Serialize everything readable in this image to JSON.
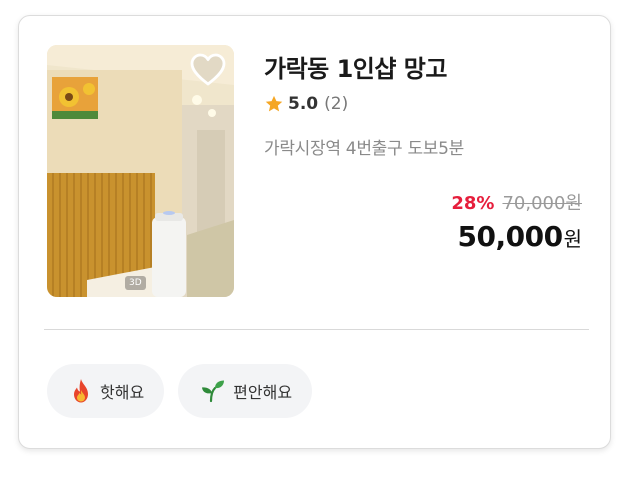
{
  "listing": {
    "title": "가락동 1인샵 망고",
    "rating": {
      "score": "5.0",
      "count": "(2)",
      "icon": "star-icon"
    },
    "location": "가락시장역 4번출구 도보5분",
    "price": {
      "discount": "28%",
      "original": "70,000원",
      "final_amount": "50,000",
      "final_unit": "원"
    },
    "thumbnail": {
      "tag": "3D"
    },
    "favorite_icon": "heart-outline-icon"
  },
  "tags": [
    {
      "label": "핫해요",
      "icon": "fire-icon"
    },
    {
      "label": "편안해요",
      "icon": "sprout-icon"
    }
  ],
  "colors": {
    "discount": "#e61e3c",
    "star": "#f5a623",
    "chip_bg": "#f3f4f6",
    "card_border": "#dcdcdc"
  }
}
